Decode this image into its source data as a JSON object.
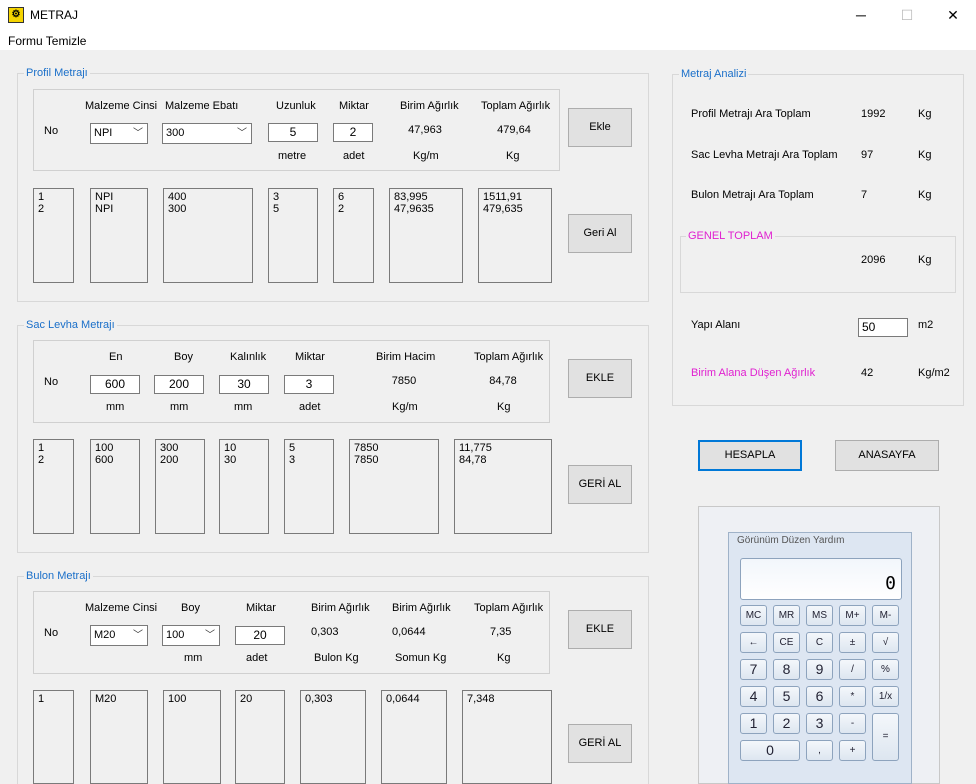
{
  "window": {
    "title": "METRAJ",
    "menu": "Formu Temizle",
    "min": "─",
    "max": "☐",
    "close": "✕"
  },
  "profil": {
    "legend": "Profil Metrajı",
    "h_cins": "Malzeme Cinsi",
    "h_ebat": "Malzeme Ebatı",
    "h_uzunluk": "Uzunluk",
    "h_miktar": "Miktar",
    "h_birim": "Birim Ağırlık",
    "h_toplam": "Toplam Ağırlık",
    "no": "No",
    "cins": "NPI",
    "ebat": "300",
    "uzunluk": "5",
    "miktar": "2",
    "birim": "47,963",
    "toplam": "479,64",
    "u_metre": "metre",
    "u_adet": "adet",
    "u_kgm": "Kg/m",
    "u_kg": "Kg",
    "l_no": "1\n2",
    "l_cins": "NPI\nNPI",
    "l_ebat": "400\n300",
    "l_uzun": "3\n5",
    "l_miktar": "6\n2",
    "l_birim": "83,995\n47,9635",
    "l_toplam": "1511,91\n479,635",
    "btn_ekle": "Ekle",
    "btn_geri": "Geri Al"
  },
  "sac": {
    "legend": "Sac Levha Metrajı",
    "h_en": "En",
    "h_boy": "Boy",
    "h_kal": "Kalınlık",
    "h_miktar": "Miktar",
    "h_hacim": "Birim Hacim",
    "h_toplam": "Toplam Ağırlık",
    "no": "No",
    "en": "600",
    "boy": "200",
    "kal": "30",
    "miktar": "3",
    "hacim": "7850",
    "toplam": "84,78",
    "u_mm": "mm",
    "u_adet": "adet",
    "u_kgm": "Kg/m",
    "u_kg": "Kg",
    "l_no": "1\n2",
    "l_en": "100\n600",
    "l_boy": "300\n200",
    "l_kal": "10\n30",
    "l_miktar": "5\n3",
    "l_hacim": "7850\n7850",
    "l_toplam": "11,775\n84,78",
    "btn_ekle": "EKLE",
    "btn_geri": "GERİ AL"
  },
  "bulon": {
    "legend": "Bulon Metrajı",
    "h_cins": "Malzeme  Cinsi",
    "h_boy": "Boy",
    "h_miktar": "Miktar",
    "h_birim1": "Birim Ağırlık",
    "h_birim2": "Birim Ağırlık",
    "h_toplam": "Toplam Ağırlık",
    "no": "No",
    "cins": "M20",
    "boy": "100",
    "miktar": "20",
    "birim1": "0,303",
    "birim2": "0,0644",
    "toplam": "7,35",
    "u_mm": "mm",
    "u_adet": "adet",
    "u_bulon": "Bulon Kg",
    "u_somun": "Somun Kg",
    "u_kg": "Kg",
    "l_no": "1",
    "l_cins": "M20",
    "l_boy": "100",
    "l_miktar": "20",
    "l_birim1": "0,303",
    "l_birim2": "0,0644",
    "l_toplam": "7,348",
    "btn_ekle": "EKLE",
    "btn_geri": "GERİ AL"
  },
  "analiz": {
    "legend": "Metraj Analizi",
    "r1_label": "Profil Metrajı Ara Toplam",
    "r1_val": "1992",
    "r1_unit": "Kg",
    "r2_label": "Sac Levha Metrajı Ara Toplam",
    "r2_val": "97",
    "r2_unit": "Kg",
    "r3_label": "Bulon Metrajı Ara Toplam",
    "r3_val": "7",
    "r3_unit": "Kg",
    "genel_legend": "GENEL TOPLAM",
    "genel_val": "2096",
    "genel_unit": "Kg",
    "yapi_label": "Yapı Alanı",
    "yapi_val": "50",
    "yapi_unit": "m2",
    "birim_label": "Birim Alana Düşen Ağırlık",
    "birim_val": "42",
    "birim_unit": "Kg/m2"
  },
  "buttons": {
    "hesapla": "HESAPLA",
    "anasayfa": "ANASAYFA"
  },
  "calculator": {
    "menu": "Görünüm   Düzen   Yardım",
    "display": "0",
    "keys": [
      "MC",
      "MR",
      "MS",
      "M+",
      "M-",
      "←",
      "CE",
      "C",
      "±",
      "√",
      "7",
      "8",
      "9",
      "/",
      "%",
      "4",
      "5",
      "6",
      "*",
      "1/x",
      "1",
      "2",
      "3",
      "-",
      "=",
      "0",
      ",",
      "+"
    ]
  }
}
